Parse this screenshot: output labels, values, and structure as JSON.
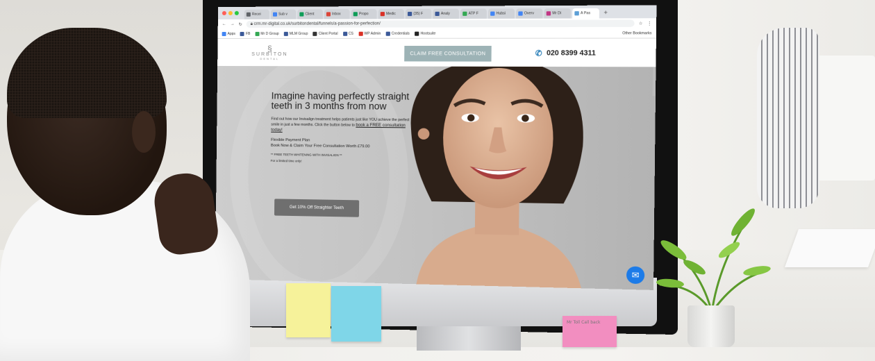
{
  "browser": {
    "tabs": [
      {
        "label": "Recei",
        "color": "#5f6368"
      },
      {
        "label": "Sub v",
        "color": "#4285f4"
      },
      {
        "label": "Client",
        "color": "#0f9d58"
      },
      {
        "label": "Inbox",
        "color": "#db4437"
      },
      {
        "label": "Propo",
        "color": "#0f9d58"
      },
      {
        "label": "Medic",
        "color": "#d93025"
      },
      {
        "label": "(35) F",
        "color": "#3b5998"
      },
      {
        "label": "Analy",
        "color": "#3b5998"
      },
      {
        "label": "ATP F",
        "color": "#34a853"
      },
      {
        "label": "Hubsi",
        "color": "#4285f4"
      },
      {
        "label": "Overv",
        "color": "#4285f4"
      },
      {
        "label": "Mr Di",
        "color": "#c13584"
      },
      {
        "label": "A Pas",
        "color": "#5c9fd6"
      }
    ],
    "new_tab": "+",
    "url": "crm.mr-digital.co.uk/surbitondental/funnels/a-passion-for-perfection/",
    "bookmarks": [
      {
        "label": "Apps",
        "color": "#4285f4"
      },
      {
        "label": "FB",
        "color": "#3b5998"
      },
      {
        "label": "Mr D Group",
        "color": "#34a853"
      },
      {
        "label": "MLM Group",
        "color": "#3b5998"
      },
      {
        "label": "Client Portal",
        "color": "#333333"
      },
      {
        "label": "CS",
        "color": "#3b5998"
      },
      {
        "label": "WP Admin",
        "color": "#d93025"
      },
      {
        "label": "Credentials",
        "color": "#3b5998"
      },
      {
        "label": "Hootsuite",
        "color": "#222222"
      }
    ],
    "other_bookmarks": "Other Bookmarks"
  },
  "site": {
    "logo_name": "SURBITON",
    "logo_sub": "DENTAL",
    "cta_top": "CLAIM FREE CONSULTATION",
    "phone": "020 8399 4311",
    "hero": {
      "headline": "Imagine having perfectly straight teeth in 3 months from now",
      "body_start": "Find out how our Invisalign treatment helps patients just like YOU achieve the perfect smile in just a few months. Click the button below to",
      "body_link": "book a FREE consultation today!",
      "plan_line1": "Flexible Payment Plan",
      "plan_line2": "Book Now & Claim Your Free Consultation Worth £79.00",
      "whitening": "** FREE TEETH WHITENING WITH INVISALIGN **",
      "limited": "For a limited time only!",
      "button": "Get 10% Off Straighter Teeth"
    }
  },
  "colors": {
    "cta_top_bg": "#9db3b6",
    "hero_button_bg": "#6f6f6f",
    "messenger_blue": "#1c7be8",
    "phone_icon": "#2a7fb8"
  },
  "sticky_notes": [
    {
      "text": "",
      "color": "#f6f29a"
    },
    {
      "text": "",
      "color": "#7fd6e8"
    },
    {
      "text": "Mr Toll Call back",
      "color": "#f28ec0"
    }
  ]
}
